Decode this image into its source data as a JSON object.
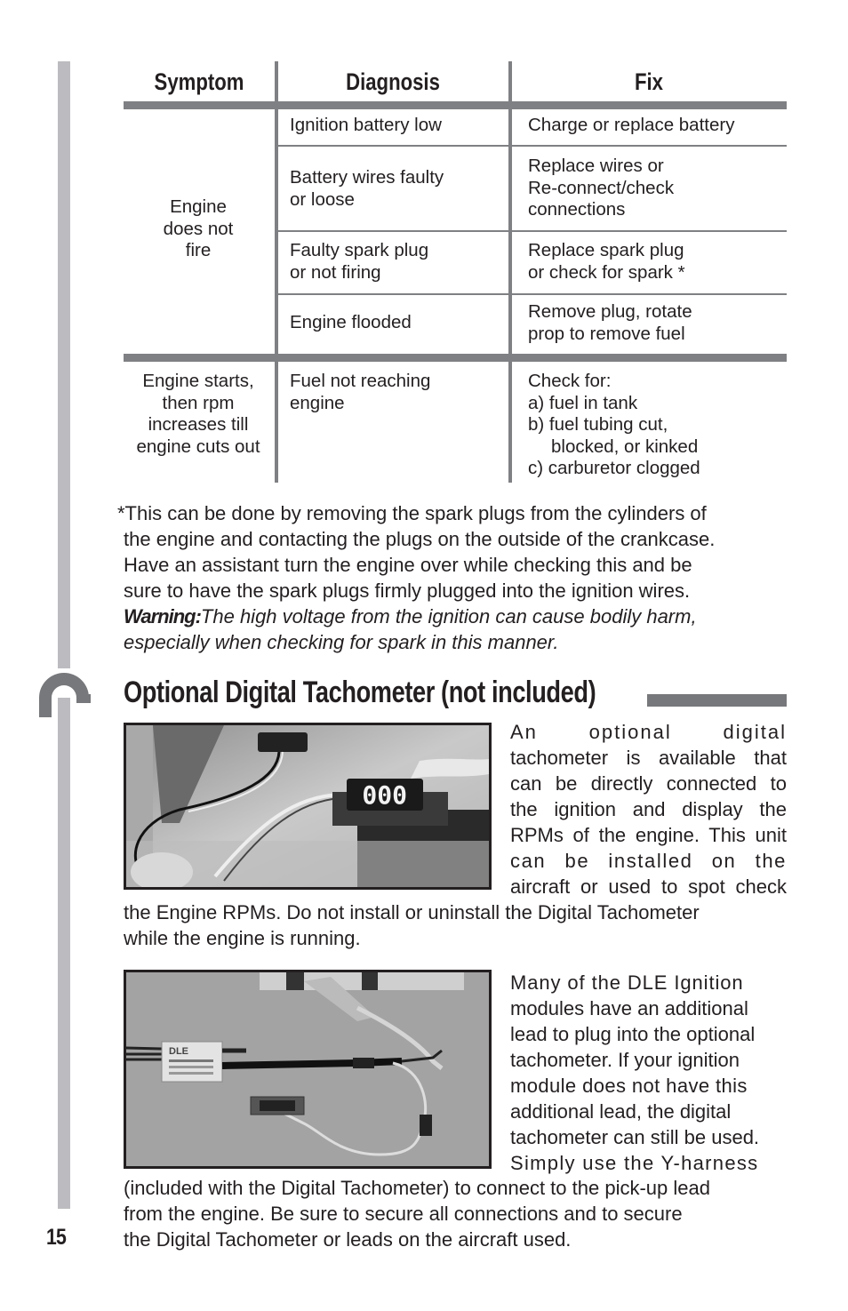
{
  "page_number": "15",
  "table": {
    "headers": [
      "Symptom",
      "Diagnosis",
      "Fix"
    ],
    "groups": [
      {
        "symptom": [
          "Engine",
          "does not",
          "fire"
        ],
        "rows": [
          {
            "diagnosis": [
              "Ignition battery low"
            ],
            "fix": [
              "Charge or replace battery"
            ]
          },
          {
            "diagnosis": [
              "Battery wires faulty",
              "or loose"
            ],
            "fix": [
              "Replace wires or",
              "Re-connect/check",
              "connections"
            ]
          },
          {
            "diagnosis": [
              "Faulty spark plug",
              "or not firing"
            ],
            "fix": [
              "Replace spark plug",
              "or check for spark *"
            ]
          },
          {
            "diagnosis": [
              "Engine flooded"
            ],
            "fix": [
              "Remove plug, rotate",
              "prop to remove fuel"
            ]
          }
        ]
      },
      {
        "symptom": [
          "Engine starts,",
          "then rpm",
          "increases till",
          "engine cuts out"
        ],
        "rows": [
          {
            "diagnosis": [
              "Fuel not reaching",
              "engine"
            ],
            "fix": [
              "Check for:",
              "a) fuel in tank",
              "b) fuel tubing cut,",
              "blocked, or kinked",
              "c) carburetor clogged"
            ]
          }
        ]
      }
    ]
  },
  "footnote": {
    "lines": [
      "*This can be done by removing the spark plugs from the cylinders of",
      "the engine and contacting the plugs on the outside of the crankcase.",
      "Have an assistant turn the engine over while checking this and be",
      "sure to have the spark plugs firmly plugged into the ignition wires."
    ],
    "warning_label": "Warning:",
    "warning_line1": "The high voltage from the ignition can cause bodily harm,",
    "warning_line2": "especially when checking for spark in this manner."
  },
  "section": {
    "title": "Optional Digital Tachometer (not included)",
    "photo1_alt": "Digital tachometer display showing 000 connected to sensor",
    "photo1_display": "000",
    "para1_side": [
      "An optional digital",
      "tachometer is available that",
      "can be directly connected to",
      "the ignition and display the",
      "RPMs of the engine. This unit",
      "can be installed on the",
      "aircraft or used to spot check"
    ],
    "para1_full": [
      "the Engine RPMs. Do not install or uninstall the Digital Tachometer",
      "while the engine is running."
    ],
    "photo2_alt": "DLE electronic ignition module with Y-harness and tachometer",
    "photo2_label": "DLE",
    "para2_side": [
      "Many of the DLE Ignition",
      "modules have an additional",
      "lead to plug into the optional",
      "tachometer. If your ignition",
      "module does not have this",
      "additional lead, the digital",
      "tachometer can still be used.",
      "Simply use the Y-harness"
    ],
    "para2_full": [
      "(included with the Digital Tachometer) to connect to the pick-up lead",
      "from the engine. Be sure to secure all connections and to secure",
      "the Digital Tachometer or leads on the aircraft used."
    ]
  }
}
